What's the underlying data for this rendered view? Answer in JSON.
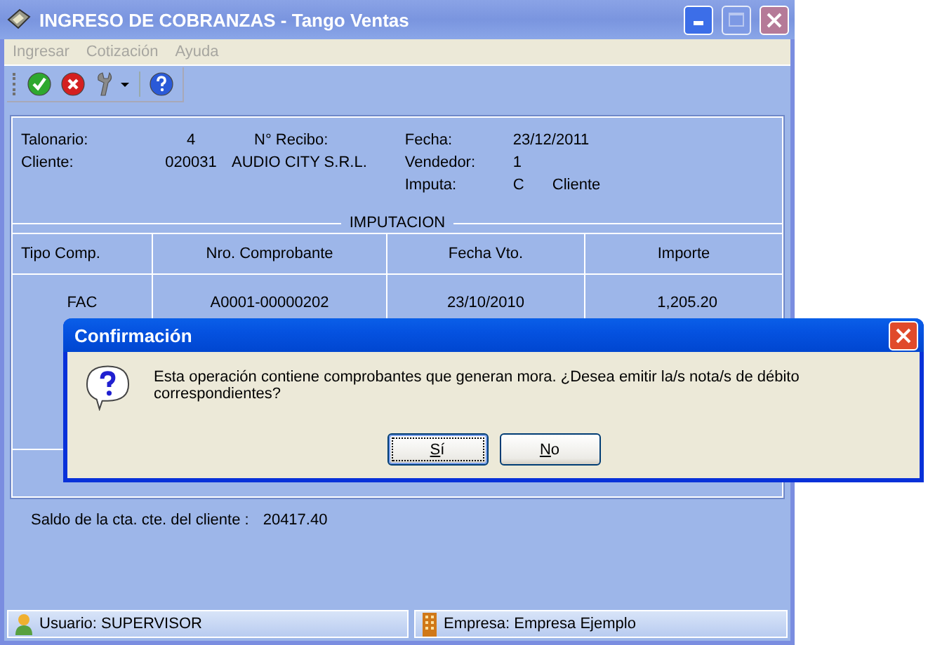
{
  "window": {
    "title": "INGRESO DE COBRANZAS - Tango Ventas"
  },
  "menu": [
    {
      "label": "Ingresar",
      "disabled": true
    },
    {
      "label": "Cotización",
      "disabled": true
    },
    {
      "label": "Ayuda",
      "disabled": true
    }
  ],
  "header": {
    "talonario": {
      "label": "Talonario:",
      "value": "4"
    },
    "recibo": {
      "label": "N° Recibo:"
    },
    "cliente": {
      "label": "Cliente:",
      "code": "020031",
      "name": "AUDIO CITY S.R.L."
    },
    "fecha": {
      "label": "Fecha:",
      "value": "23/12/2011"
    },
    "vendedor": {
      "label": "Vendedor:",
      "value": "1"
    },
    "imputa": {
      "label": "Imputa:",
      "code": "C",
      "name": "Cliente"
    }
  },
  "imputacion": {
    "title": "IMPUTACION",
    "columns": [
      "Tipo Comp.",
      "Nro. Comprobante",
      "Fecha Vto.",
      "Importe"
    ],
    "rows": [
      [
        "FAC",
        "A0001-00000202",
        "23/10/2010",
        "1,205.20"
      ]
    ]
  },
  "balance": {
    "label": "Saldo de la cta. cte. del cliente :",
    "value": "20417.40"
  },
  "dialog": {
    "title": "Confirmación",
    "message": "Esta operación contiene comprobantes que generan mora. ¿Desea emitir la/s nota/s de débito correspondientes?",
    "buttons": [
      {
        "label": "Sí",
        "focused": true
      },
      {
        "label": "No",
        "focused": false
      }
    ]
  },
  "status_bar": [
    {
      "kind": "user",
      "text": "Usuario: SUPERVISOR"
    },
    {
      "kind": "company",
      "text": "Empresa: Empresa Ejemplo"
    }
  ]
}
